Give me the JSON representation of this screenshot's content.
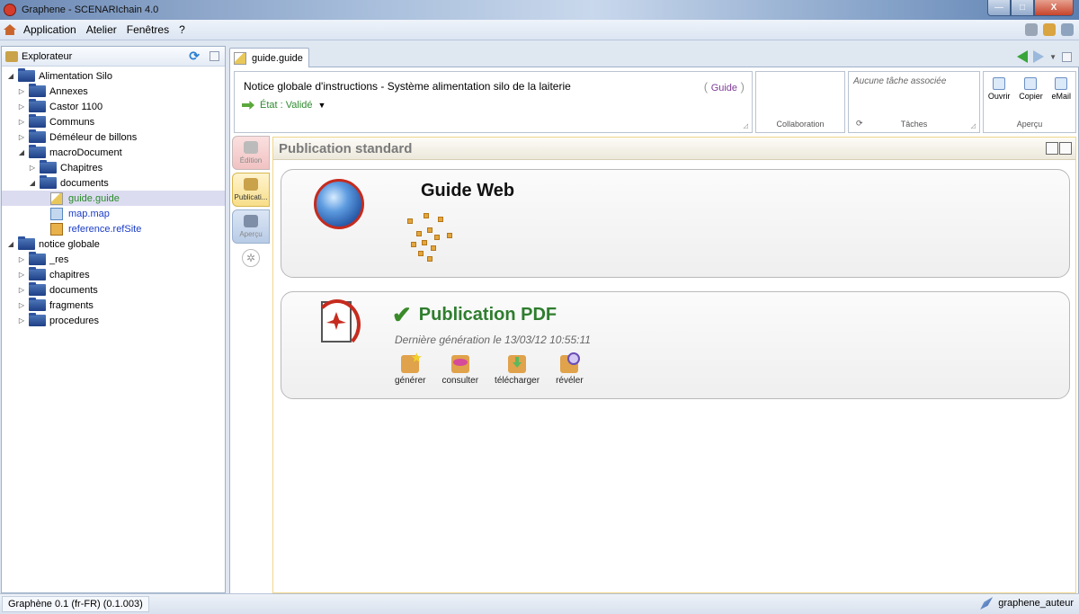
{
  "window": {
    "title": "Graphene - SCENARIchain 4.0",
    "min_label": "—",
    "max_label": "□",
    "close_label": "X"
  },
  "menu": {
    "items": [
      "Application",
      "Atelier",
      "Fenêtres",
      "?"
    ]
  },
  "explorer": {
    "title": "Explorateur",
    "tree": [
      {
        "label": "Alimentation Silo",
        "level": 0,
        "twisty": "◢",
        "kind": "folder"
      },
      {
        "label": "Annexes",
        "level": 1,
        "twisty": "▷",
        "kind": "folder"
      },
      {
        "label": "Castor 1100",
        "level": 1,
        "twisty": "▷",
        "kind": "folder"
      },
      {
        "label": "Communs",
        "level": 1,
        "twisty": "▷",
        "kind": "folder"
      },
      {
        "label": "Déméleur de billons",
        "level": 1,
        "twisty": "▷",
        "kind": "folder"
      },
      {
        "label": "macroDocument",
        "level": 1,
        "twisty": "◢",
        "kind": "folder"
      },
      {
        "label": "Chapitres",
        "level": 2,
        "twisty": "▷",
        "kind": "folder"
      },
      {
        "label": "documents",
        "level": 2,
        "twisty": "◢",
        "kind": "folder"
      },
      {
        "label": "guide.guide",
        "level": 3,
        "twisty": "",
        "kind": "guide",
        "selected": true
      },
      {
        "label": "map.map",
        "level": 3,
        "twisty": "",
        "kind": "map"
      },
      {
        "label": "reference.refSite",
        "level": 3,
        "twisty": "",
        "kind": "ref"
      },
      {
        "label": "notice globale",
        "level": 0,
        "twisty": "◢",
        "kind": "folder"
      },
      {
        "label": "_res",
        "level": 1,
        "twisty": "▷",
        "kind": "folder"
      },
      {
        "label": "chapitres",
        "level": 1,
        "twisty": "▷",
        "kind": "folder"
      },
      {
        "label": "documents",
        "level": 1,
        "twisty": "▷",
        "kind": "folder"
      },
      {
        "label": "fragments",
        "level": 1,
        "twisty": "▷",
        "kind": "folder"
      },
      {
        "label": "procedures",
        "level": 1,
        "twisty": "▷",
        "kind": "folder"
      }
    ]
  },
  "editor": {
    "tab_label": "guide.guide",
    "doc_title": "Notice globale d'instructions - Système alimentation silo de la laiterie",
    "doc_type": "Guide",
    "state_label": "État : Validé",
    "collaboration_caption": "Collaboration",
    "tasks_none": "Aucune tâche associée",
    "tasks_caption": "Tâches",
    "apercu_caption": "Aperçu",
    "apercu_buttons": [
      "Ouvrir",
      "Copier",
      "eMail"
    ],
    "side_tabs": [
      "Édition",
      "Publicati...",
      "Aperçu"
    ]
  },
  "publication": {
    "header": "Publication standard",
    "web": {
      "title": "Guide Web"
    },
    "pdf": {
      "title": "Publication PDF",
      "last_generation": "Dernière génération le 13/03/12 10:55:11",
      "actions": [
        "générer",
        "consulter",
        "télécharger",
        "révéler"
      ]
    }
  },
  "status": {
    "left": "Graphène 0.1 (fr-FR) (0.1.003)",
    "user": "graphene_auteur"
  }
}
